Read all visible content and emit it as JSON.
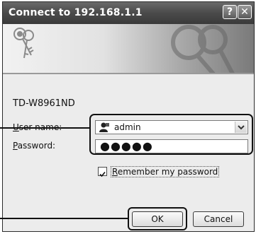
{
  "dialog": {
    "title": "Connect to 192.168.1.1",
    "help_glyph": "?",
    "close_glyph": "✕"
  },
  "banner": {
    "icon": "keys-icon"
  },
  "form": {
    "realm": "TD-W8961ND",
    "username_label_underlined": "U",
    "username_label_rest": "ser name:",
    "password_label_underlined": "P",
    "password_label_rest": "assword:",
    "username_value": "admin",
    "password_masked": "●●●●●",
    "remember_underlined": "R",
    "remember_rest": "emember my password",
    "remember_checked": true
  },
  "buttons": {
    "ok": "OK",
    "cancel": "Cancel"
  },
  "colors": {
    "titlebar": "#4a4a4a",
    "dialog_bg": "#ececec",
    "callout": "#111111"
  }
}
